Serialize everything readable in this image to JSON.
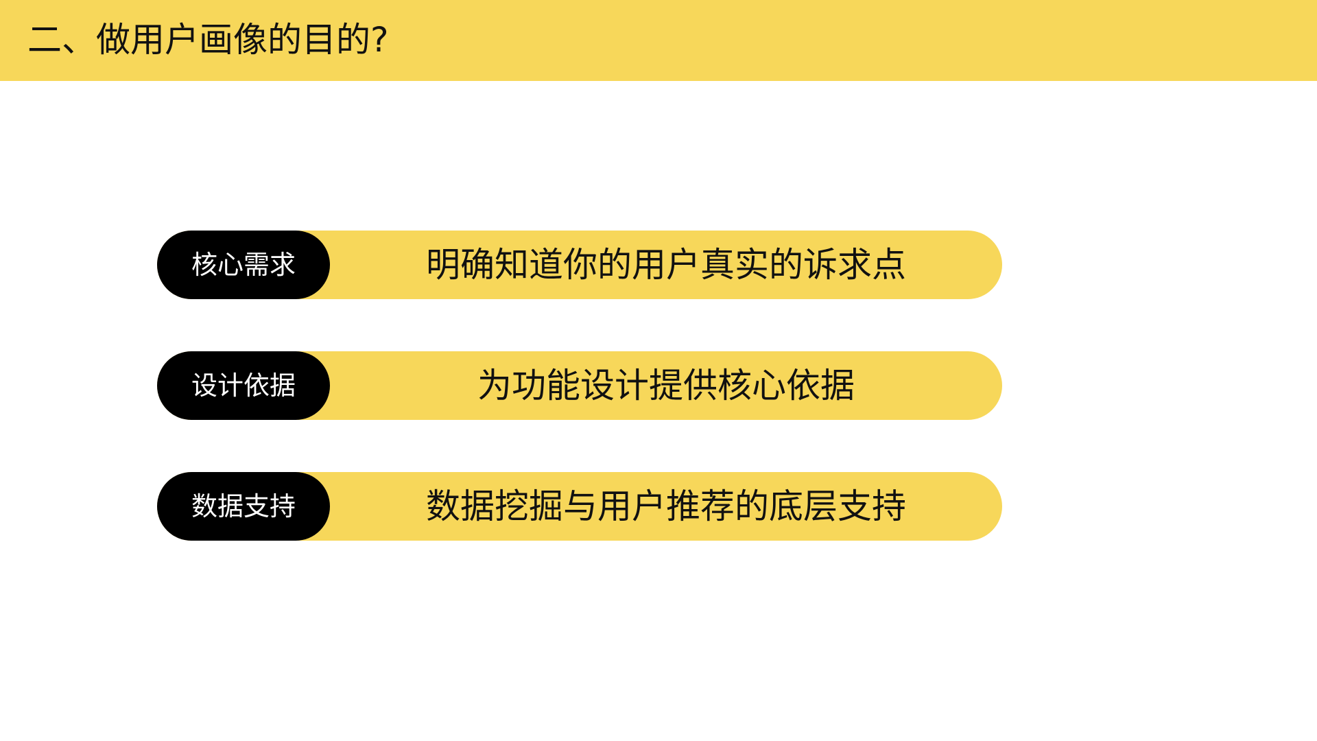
{
  "header": {
    "title": "二、做用户画像的目的?",
    "background_color": "#F7D75A"
  },
  "items": [
    {
      "tag": "核心需求",
      "description": "明确知道你的用户真实的诉求点"
    },
    {
      "tag": "设计依据",
      "description": "为功能设计提供核心依据"
    },
    {
      "tag": "数据支持",
      "description": "数据挖掘与用户推荐的底层支持"
    }
  ],
  "colors": {
    "accent": "#F7D75A",
    "tag_background": "#000000",
    "tag_text": "#FFFFFF",
    "text": "#111111"
  }
}
